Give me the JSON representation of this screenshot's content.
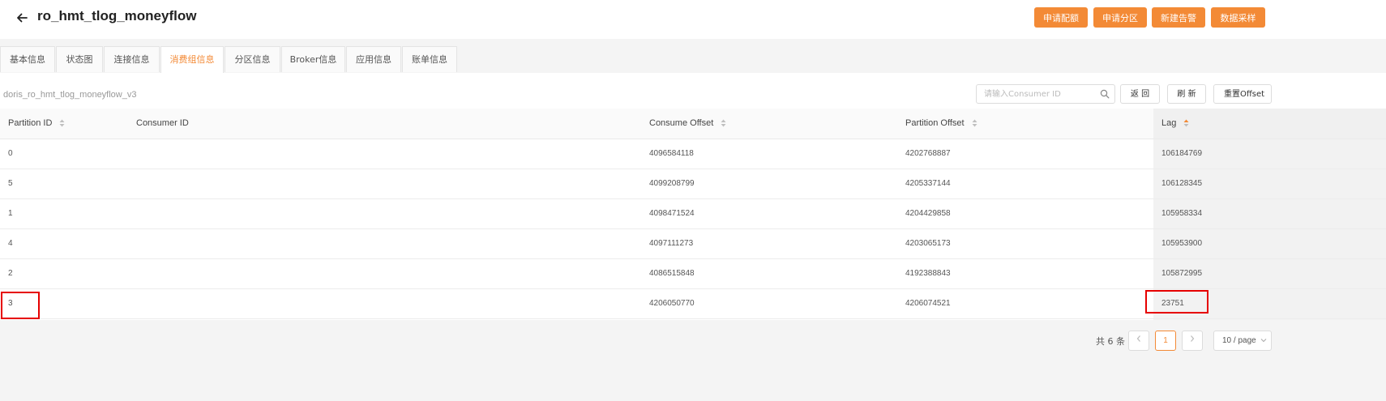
{
  "header": {
    "title": "ro_hmt_tlog_moneyflow",
    "buttons": [
      "申请配额",
      "申请分区",
      "新建告警",
      "数据采样"
    ]
  },
  "tabs": [
    {
      "label": "基本信息"
    },
    {
      "label": "状态图"
    },
    {
      "label": "连接信息"
    },
    {
      "label": "消费组信息",
      "active": true
    },
    {
      "label": "分区信息"
    },
    {
      "label": "Broker信息"
    },
    {
      "label": "应用信息"
    },
    {
      "label": "账单信息"
    }
  ],
  "consumer_group": {
    "name": "doris_ro_hmt_tlog_moneyflow_v3",
    "search_placeholder": "请输入Consumer ID",
    "back_label": "返 回",
    "refresh_label": "刷 新",
    "reset_label": "重置Offset"
  },
  "table": {
    "columns": [
      "Partition ID",
      "Consumer ID",
      "Consume Offset",
      "Partition Offset",
      "Lag"
    ],
    "sorted_column": "Lag",
    "rows": [
      {
        "partition_id": "0",
        "consumer_id": "",
        "consume_offset": "4096584118",
        "partition_offset": "4202768887",
        "lag": "106184769"
      },
      {
        "partition_id": "5",
        "consumer_id": "",
        "consume_offset": "4099208799",
        "partition_offset": "4205337144",
        "lag": "106128345"
      },
      {
        "partition_id": "1",
        "consumer_id": "",
        "consume_offset": "4098471524",
        "partition_offset": "4204429858",
        "lag": "105958334"
      },
      {
        "partition_id": "4",
        "consumer_id": "",
        "consume_offset": "4097111273",
        "partition_offset": "4203065173",
        "lag": "105953900"
      },
      {
        "partition_id": "2",
        "consumer_id": "",
        "consume_offset": "4086515848",
        "partition_offset": "4192388843",
        "lag": "105872995"
      },
      {
        "partition_id": "3",
        "consumer_id": "",
        "consume_offset": "4206050770",
        "partition_offset": "4206074521",
        "lag": "23751"
      }
    ]
  },
  "pagination": {
    "total": "共 6 条",
    "current_page": "1",
    "page_size": "10 / page"
  },
  "colors": {
    "accent": "#f38a36",
    "highlight": "#e60000"
  }
}
